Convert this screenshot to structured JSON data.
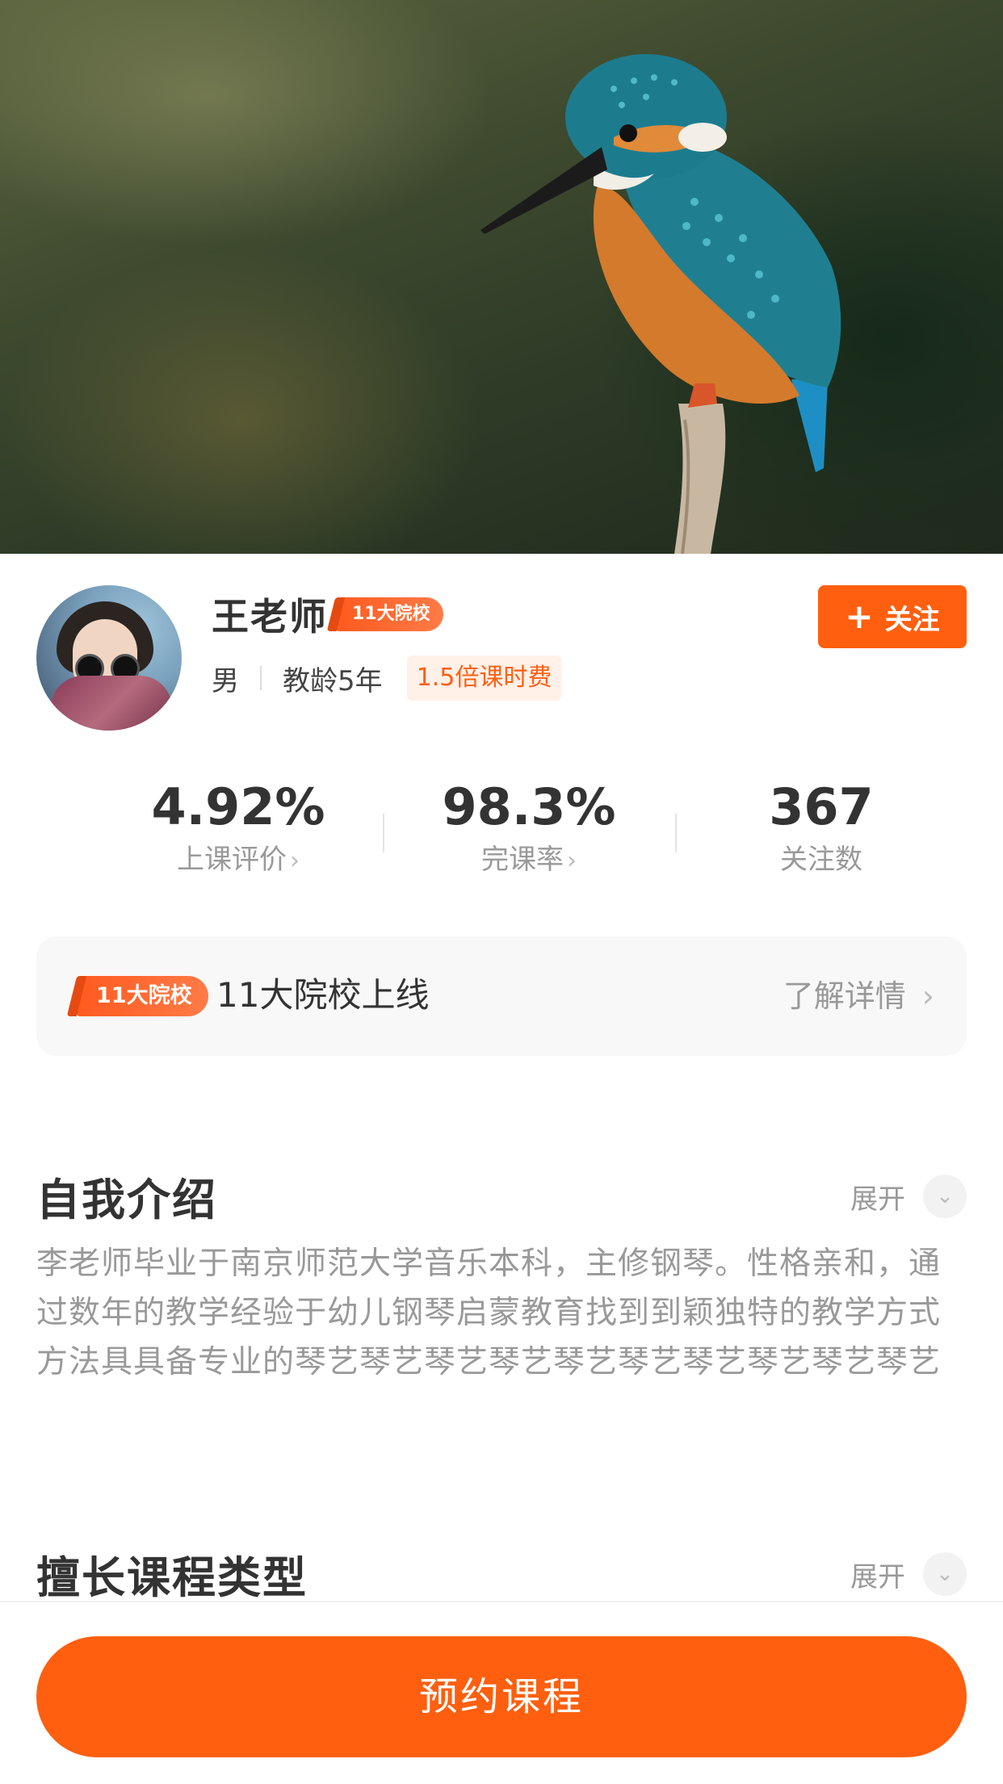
{
  "hero": {
    "image": "kingfisher-photo"
  },
  "teacher": {
    "name": "王老师",
    "school_tag": "11大院校",
    "gender": "男",
    "teaching_years": "教龄5年",
    "fee_tag": "1.5倍课时费"
  },
  "follow": {
    "icon": "plus-icon",
    "label": "关注"
  },
  "stats": [
    {
      "value": "4.92%",
      "label": "上课评价",
      "has_chevron": true
    },
    {
      "value": "98.3%",
      "label": "完课率",
      "has_chevron": true
    },
    {
      "value": "367",
      "label": "关注数",
      "has_chevron": false
    }
  ],
  "promo": {
    "tag": "11大院校",
    "title": "11大院校上线",
    "more_label": "了解详情"
  },
  "intro": {
    "title": "自我介绍",
    "expand_label": "展开",
    "text": "李老师毕业于南京师范大学音乐本科，主修钢琴。性格亲和，通过数年的教学经验于幼儿钢琴启蒙教育找到到颖独特的教学方式方法具具备专业的琴艺琴艺琴艺琴艺琴艺琴艺琴艺琴艺琴艺琴艺"
  },
  "courses": {
    "title": "擅长课程类型",
    "expand_label": "展开"
  },
  "bottom": {
    "book_label": "预约课程"
  },
  "colors": {
    "accent": "#ff5f0f",
    "fee_bg": "#fff0e8"
  }
}
